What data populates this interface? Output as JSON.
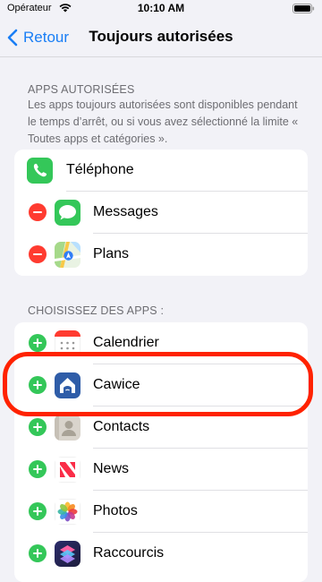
{
  "status_bar": {
    "carrier": "Opérateur",
    "time": "10:10 AM"
  },
  "nav": {
    "back_label": "Retour",
    "title": "Toujours autorisées"
  },
  "allowed_section": {
    "header": "APPS AUTORISÉES",
    "description": "Les apps toujours autorisées sont disponibles pendant le temps d’arrêt, ou si vous avez sélectionné la limite « Toutes apps et catégories ».",
    "items": [
      {
        "label": "Téléphone",
        "icon": "phone-icon",
        "removable": false
      },
      {
        "label": "Messages",
        "icon": "messages-icon",
        "removable": true
      },
      {
        "label": "Plans",
        "icon": "maps-icon",
        "removable": true
      }
    ]
  },
  "choose_section": {
    "header": "CHOISISSEZ DES APPS :",
    "items": [
      {
        "label": "Calendrier",
        "icon": "calendar-icon"
      },
      {
        "label": "Cawice",
        "icon": "cawice-icon"
      },
      {
        "label": "Contacts",
        "icon": "contacts-icon"
      },
      {
        "label": "News",
        "icon": "news-icon"
      },
      {
        "label": "Photos",
        "icon": "photos-icon"
      },
      {
        "label": "Raccourcis",
        "icon": "shortcuts-icon"
      }
    ]
  },
  "colors": {
    "accent": "#1a7ef5",
    "add": "#34c759",
    "remove": "#ff3b30",
    "highlight": "#ff2200",
    "background": "#f2f2f7"
  }
}
